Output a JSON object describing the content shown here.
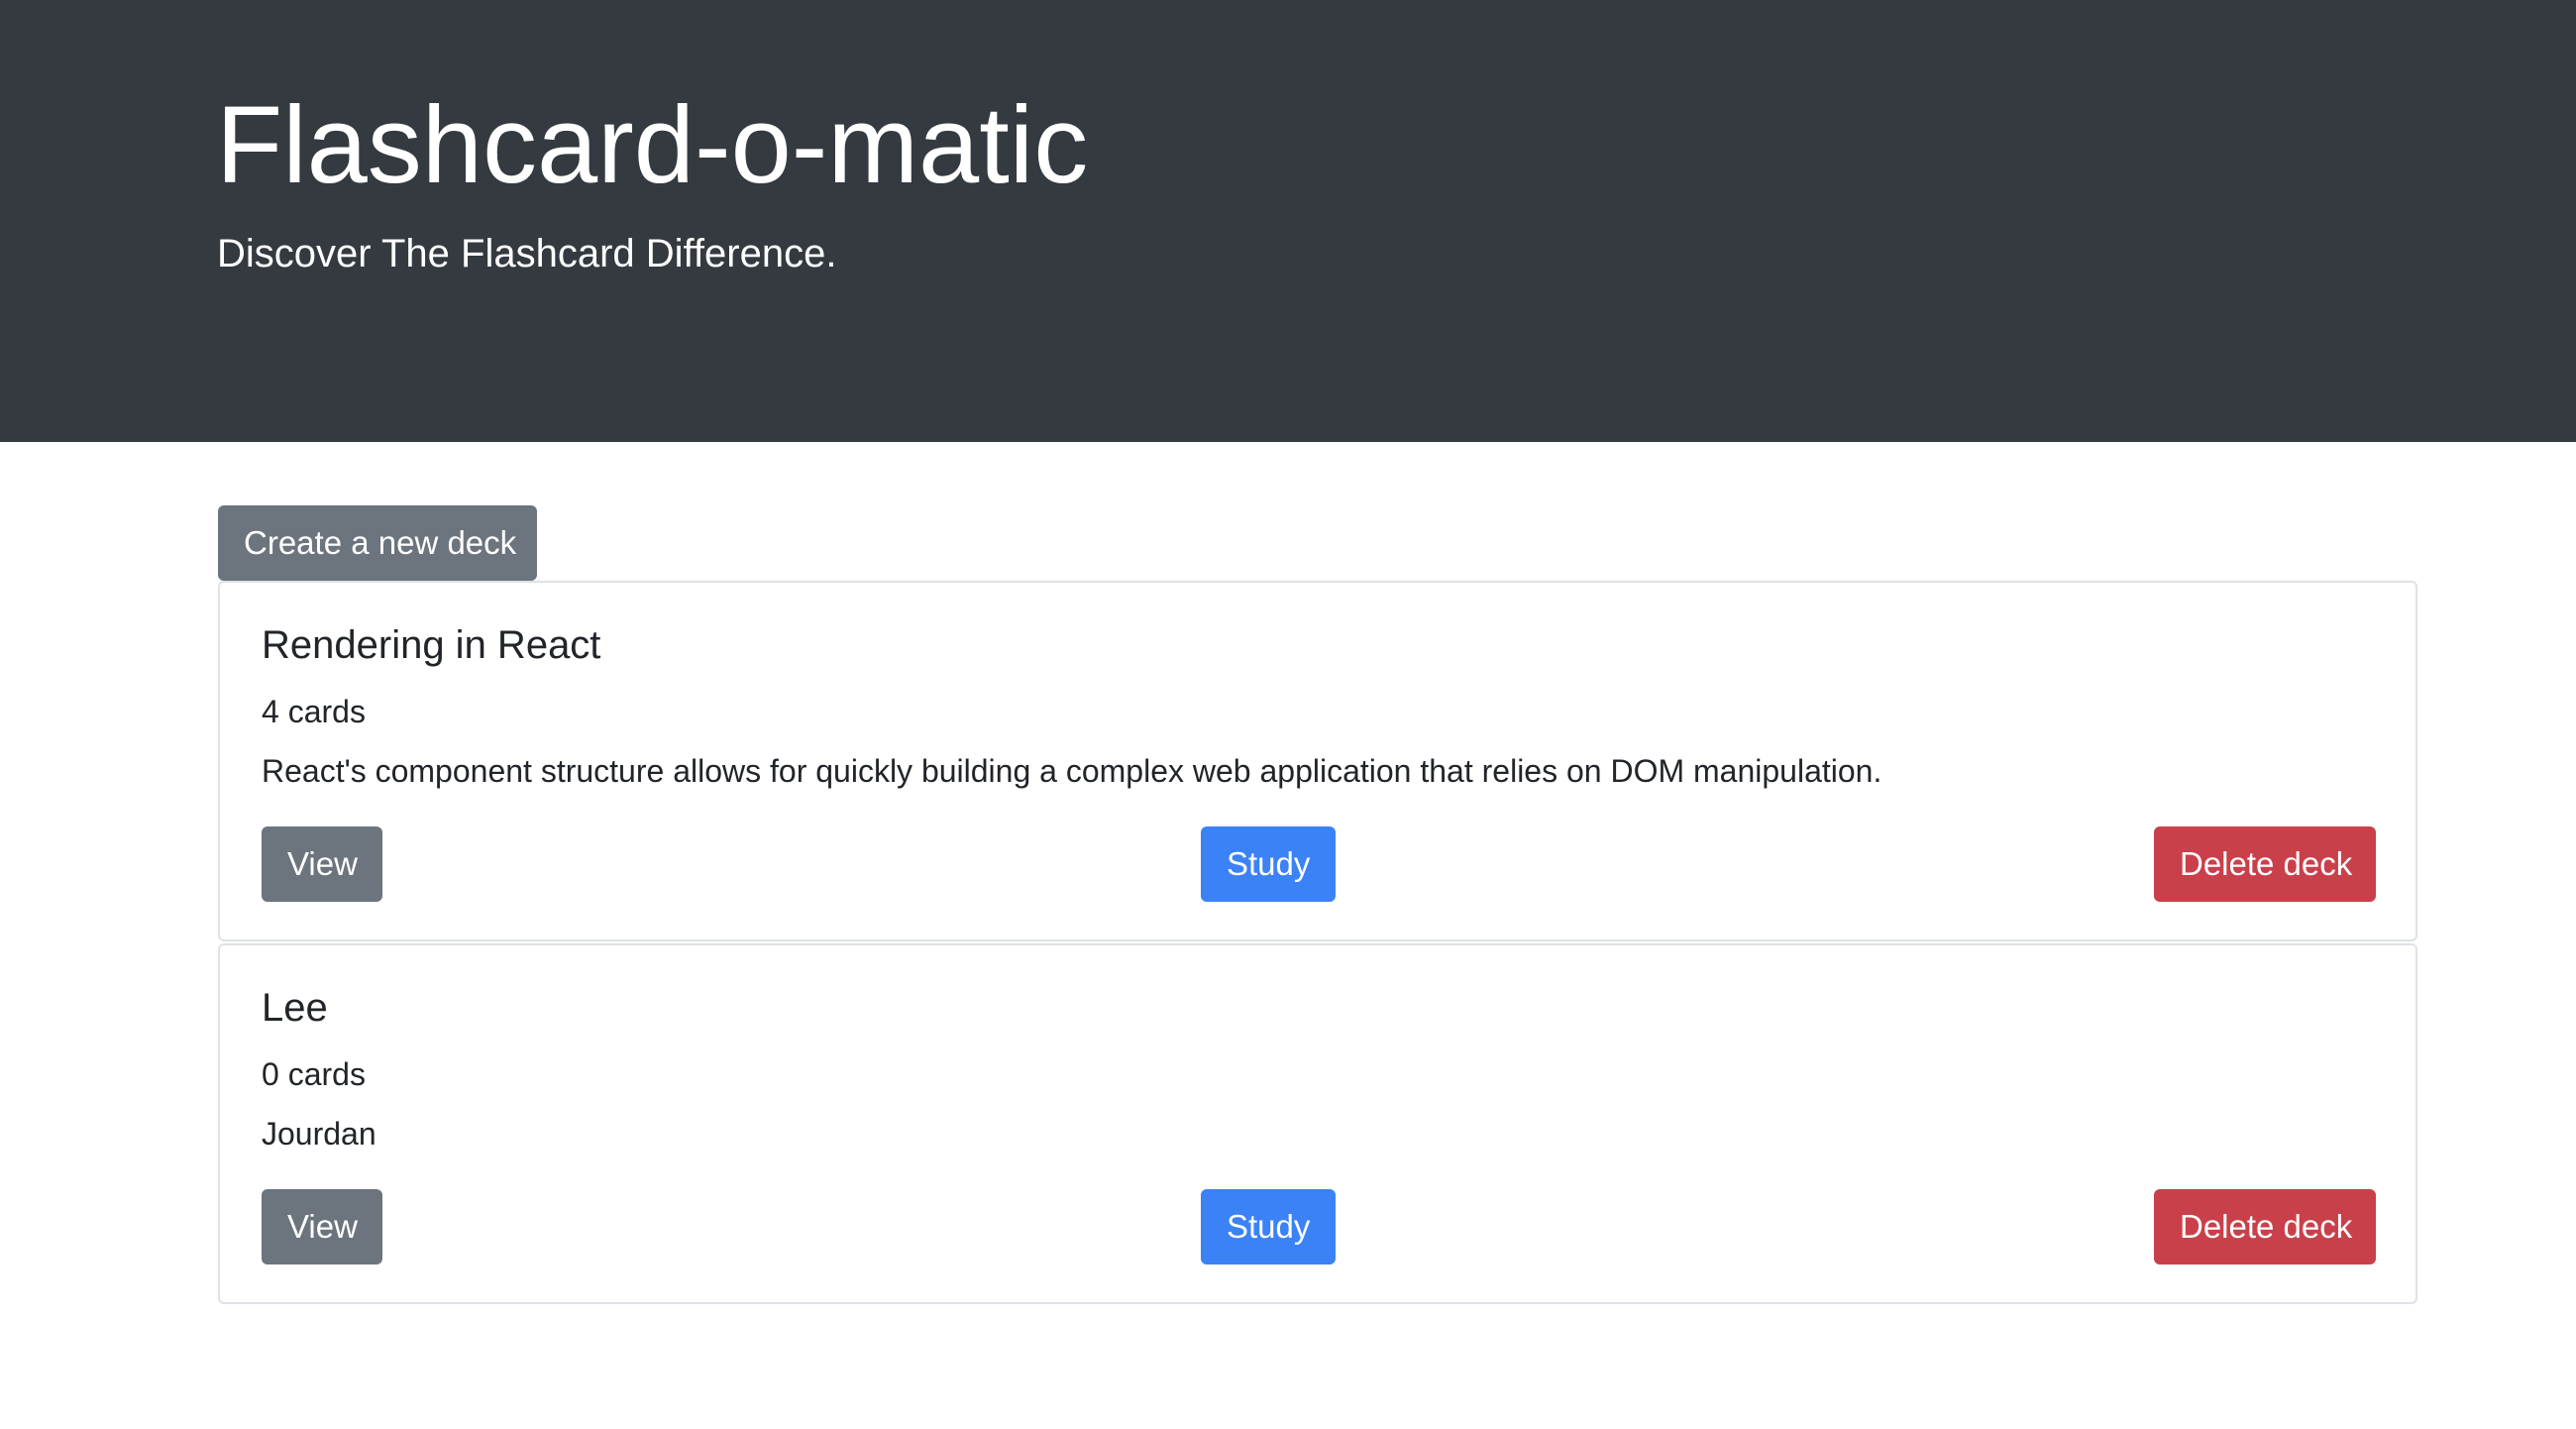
{
  "header": {
    "title": "Flashcard-o-matic",
    "subtitle": "Discover The Flashcard Difference."
  },
  "actions": {
    "create_deck_label": "Create a new deck"
  },
  "decks": [
    {
      "name": "Rendering in React",
      "card_count": "4 cards",
      "description": "React's component structure allows for quickly building a complex web application that relies on DOM manipulation.",
      "view_label": "View",
      "study_label": "Study",
      "delete_label": "Delete deck"
    },
    {
      "name": "Lee",
      "card_count": "0 cards",
      "description": "Jourdan",
      "view_label": "View",
      "study_label": "Study",
      "delete_label": "Delete deck"
    }
  ],
  "colors": {
    "header_bg": "#343a40",
    "secondary": "#6c757d",
    "primary": "#3b82f6",
    "danger": "#c9404b"
  }
}
